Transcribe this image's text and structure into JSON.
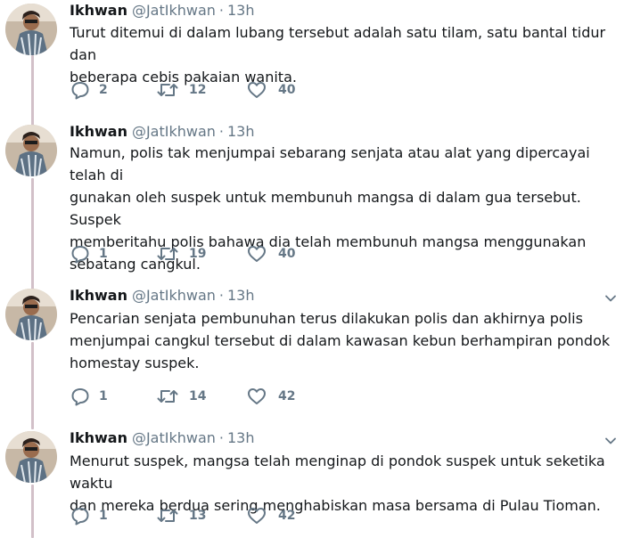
{
  "colors": {
    "text": "#14171a",
    "secondary": "#657786",
    "thread_line": "#d2c0c8",
    "background": "#ffffff"
  },
  "icons": {
    "reply": "reply-icon",
    "retweet": "retweet-icon",
    "like": "heart-icon",
    "caret": "chevron-down-icon"
  },
  "tweets": [
    {
      "name": "Ikhwan",
      "handle": "@JatIkhwan",
      "separator": "·",
      "time": "13h",
      "text": "Turut ditemui di dalam lubang tersebut adalah satu tilam, satu bantal tidur dan\nbeberapa cebis pakaian wanita.",
      "replies": "2",
      "retweets": "12",
      "likes": "40"
    },
    {
      "name": "Ikhwan",
      "handle": "@JatIkhwan",
      "separator": "·",
      "time": "13h",
      "text": "Namun, polis tak menjumpai sebarang senjata atau alat yang dipercayai telah di\ngunakan oleh suspek untuk membunuh mangsa di dalam gua tersebut. Suspek\nmemberitahu polis bahawa dia telah membunuh mangsa menggunakan\nsebatang cangkul.",
      "replies": "1",
      "retweets": "19",
      "likes": "40"
    },
    {
      "name": "Ikhwan",
      "handle": "@JatIkhwan",
      "separator": "·",
      "time": "13h",
      "text": "Pencarian senjata pembunuhan terus dilakukan polis dan akhirnya polis\nmenjumpai cangkul tersebut di dalam kawasan kebun berhampiran pondok\nhomestay suspek.",
      "replies": "1",
      "retweets": "14",
      "likes": "42"
    },
    {
      "name": "Ikhwan",
      "handle": "@JatIkhwan",
      "separator": "·",
      "time": "13h",
      "text": "Menurut suspek, mangsa telah menginap di pondok suspek untuk seketika waktu\ndan mereka berdua sering menghabiskan masa bersama di Pulau Tioman.",
      "replies": "1",
      "retweets": "13",
      "likes": "42"
    }
  ]
}
